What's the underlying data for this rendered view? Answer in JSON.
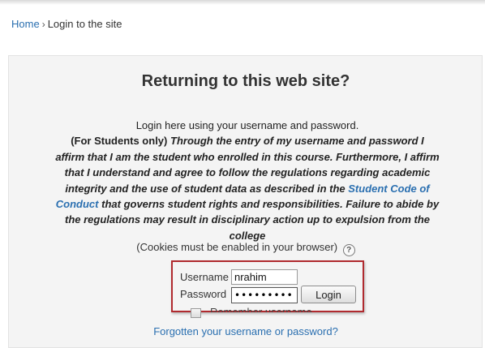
{
  "breadcrumb": {
    "home": "Home",
    "separator": "›",
    "current": "Login to the site"
  },
  "login": {
    "title": "Returning to this web site?",
    "intro": "Login here using your username and password.",
    "students_prefix": "(For Students only)",
    "statement_part1": "Through the entry of my username and password I affirm that I am the student who enrolled in this course. Furthermore, I affirm that I understand and agree to follow the regulations regarding academic integrity and the use of student data as described in the",
    "code_of_conduct_link": "Student Code of Conduct",
    "statement_part2": "that governs student rights and responsibilities. Failure to abide by the regulations may result in disciplinary action up to expulsion from the college",
    "cookies_notice": "(Cookies must be enabled in your browser)",
    "help_icon": "help-icon",
    "username_label": "Username",
    "username_value": "nrahim",
    "password_label": "Password",
    "password_mask": "•••••••••",
    "login_button": "Login",
    "remember_label": "Remember username",
    "forgot_link": "Forgotten your username or password?"
  },
  "colors": {
    "link": "#2a6fb0",
    "highlight_border": "#b02a2f",
    "panel_bg": "#f4f4f4"
  }
}
